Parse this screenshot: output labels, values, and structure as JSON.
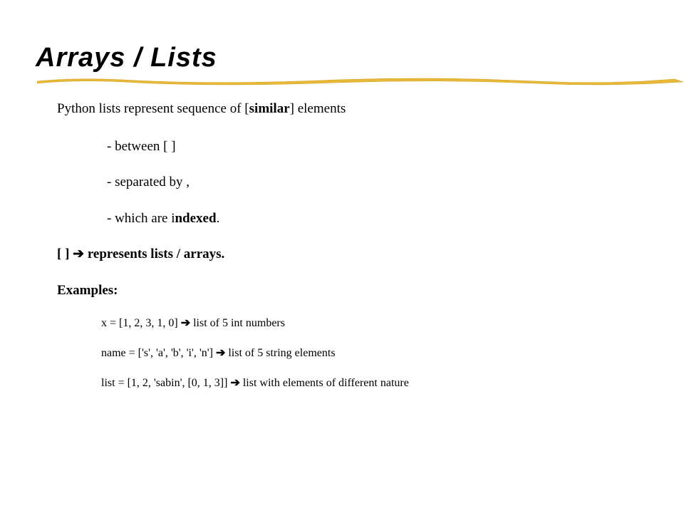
{
  "title": "Arrays / Lists",
  "intro_pre": "Python lists represent sequence of [",
  "intro_bold": "similar",
  "intro_post": "] elements",
  "bullets": {
    "b1": "- between [ ]",
    "b2": "- separated by ,",
    "b3_pre": "- which are i",
    "b3_bold": "ndexed",
    "b3_post": "."
  },
  "represents": {
    "pre": "[ ] ",
    "arrow": "➔",
    "post": " represents lists / arrays."
  },
  "examples_label": "Examples:",
  "examples": {
    "e1_pre": "x = [1, 2, 3, 1, 0] ",
    "e1_arrow": "➔",
    "e1_post": " list of 5 int numbers",
    "e2_pre": "name = ['s', 'a', 'b', 'i', 'n'] ",
    "e2_arrow": "➔",
    "e2_post": " list of 5 string elements",
    "e3_pre": "list = [1, 2, 'sabin', [0, 1, 3]] ",
    "e3_arrow": "➔",
    "e3_post": " list with elements of different nature"
  }
}
